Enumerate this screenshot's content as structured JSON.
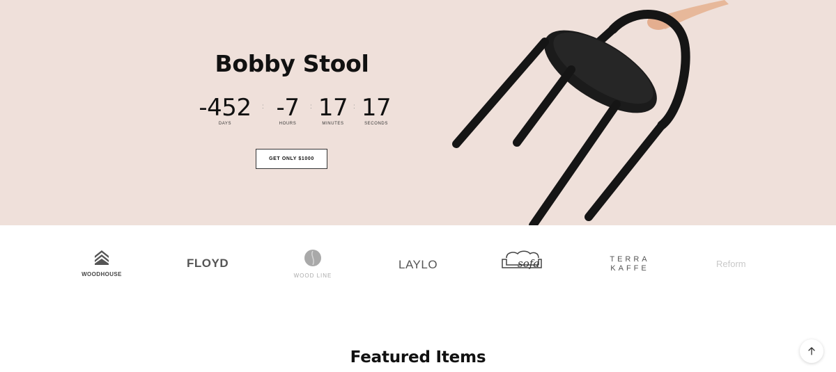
{
  "hero": {
    "title": "Bobby Stool",
    "countdown": [
      {
        "value": "-452",
        "label": "DAYS"
      },
      {
        "value": "-7",
        "label": "HOURS"
      },
      {
        "value": "17",
        "label": "MINUTES"
      },
      {
        "value": "17",
        "label": "SECONDS"
      }
    ],
    "cta_label": "GET ONLY $1000",
    "background_color": "#efe0da"
  },
  "brands": {
    "woodhouse": "WOODHOUSE",
    "floyd": "FLOYD",
    "woodline": "WOOD LINE",
    "laylo": "LAYLO",
    "sofa": "sofa",
    "terra_line1": "TERRA",
    "terra_line2": "KAFFE",
    "reform": "Reform"
  },
  "featured": {
    "title": "Featured Items"
  },
  "icons": {
    "scroll_top": "arrow-up-icon"
  }
}
